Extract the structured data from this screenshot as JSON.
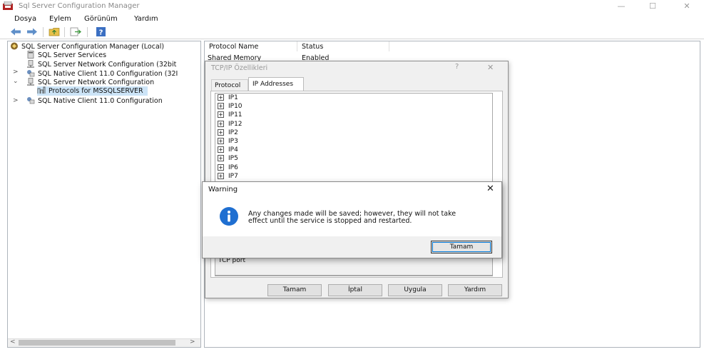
{
  "window": {
    "title": "Sql Server Configuration Manager",
    "controls": [
      "—",
      "☐",
      "✕"
    ]
  },
  "menu": [
    "Dosya",
    "Eylem",
    "Görünüm",
    "Yardım"
  ],
  "toolbar": {
    "buttons": [
      "back-icon",
      "forward-icon",
      "folder-up-icon",
      "export-icon",
      "help-icon"
    ]
  },
  "tree": {
    "root": "SQL Server Configuration Manager (Local)",
    "items": [
      "SQL Server Services",
      "SQL Server Network Configuration (32bit",
      "SQL Native Client 11.0 Configuration (32I",
      "SQL Server Network Configuration",
      "Protocols for MSSQLSERVER",
      "SQL Native Client 11.0 Configuration"
    ]
  },
  "list": {
    "columns": [
      "Protocol Name",
      "Status"
    ],
    "rows": [
      {
        "name": "Shared Memory",
        "status": "Enabled"
      }
    ]
  },
  "tcp_dialog": {
    "title": "TCP/IP Özellikleri",
    "help": "?",
    "close": "✕",
    "tabs": [
      "Protocol",
      "IP Addresses"
    ],
    "active_tab": "IP Addresses",
    "ip_items": [
      "IP1",
      "IP10",
      "IP11",
      "IP12",
      "IP2",
      "IP3",
      "IP4",
      "IP5",
      "IP6",
      "IP7"
    ],
    "port_label": "TCP port",
    "buttons": [
      "Tamam",
      "İptal",
      "Uygula",
      "Yardım"
    ]
  },
  "warning": {
    "title": "Warning",
    "close": "✕",
    "message_line1": "Any changes made will be saved; however, they will not take",
    "message_line2": "effect until the service is stopped and restarted.",
    "ok": "Tamam",
    "icon": "info-icon"
  },
  "colors": {
    "info_blue": "#1f6fd1",
    "selection": "#cce4f7"
  }
}
